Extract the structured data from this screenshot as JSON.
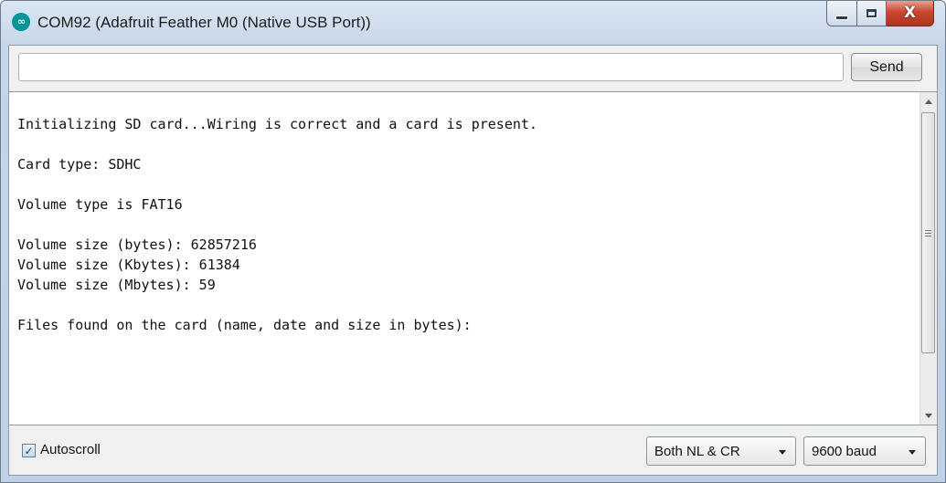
{
  "window": {
    "title": "COM92 (Adafruit Feather M0 (Native USB Port))",
    "app_icon": "arduino-logo-icon",
    "controls": {
      "minimize": "minimize-icon",
      "maximize": "maximize-icon",
      "close": "close-icon",
      "close_glyph": "X"
    }
  },
  "send": {
    "input_value": "",
    "button_label": "Send"
  },
  "output_lines": [
    "Initializing SD card...Wiring is correct and a card is present.",
    "",
    "Card type: SDHC",
    "",
    "Volume type is FAT16",
    "",
    "Volume size (bytes): 62857216",
    "Volume size (Kbytes): 61384",
    "Volume size (Mbytes): 59",
    "",
    "Files found on the card (name, date and size in bytes):"
  ],
  "footer": {
    "autoscroll_label": "Autoscroll",
    "autoscroll_checked": true,
    "line_ending": "Both NL & CR",
    "baud_rate": "9600 baud"
  },
  "colors": {
    "arduino_teal": "#00979c",
    "close_red": "#c8462f",
    "titlebar": "#c5d6ea"
  }
}
